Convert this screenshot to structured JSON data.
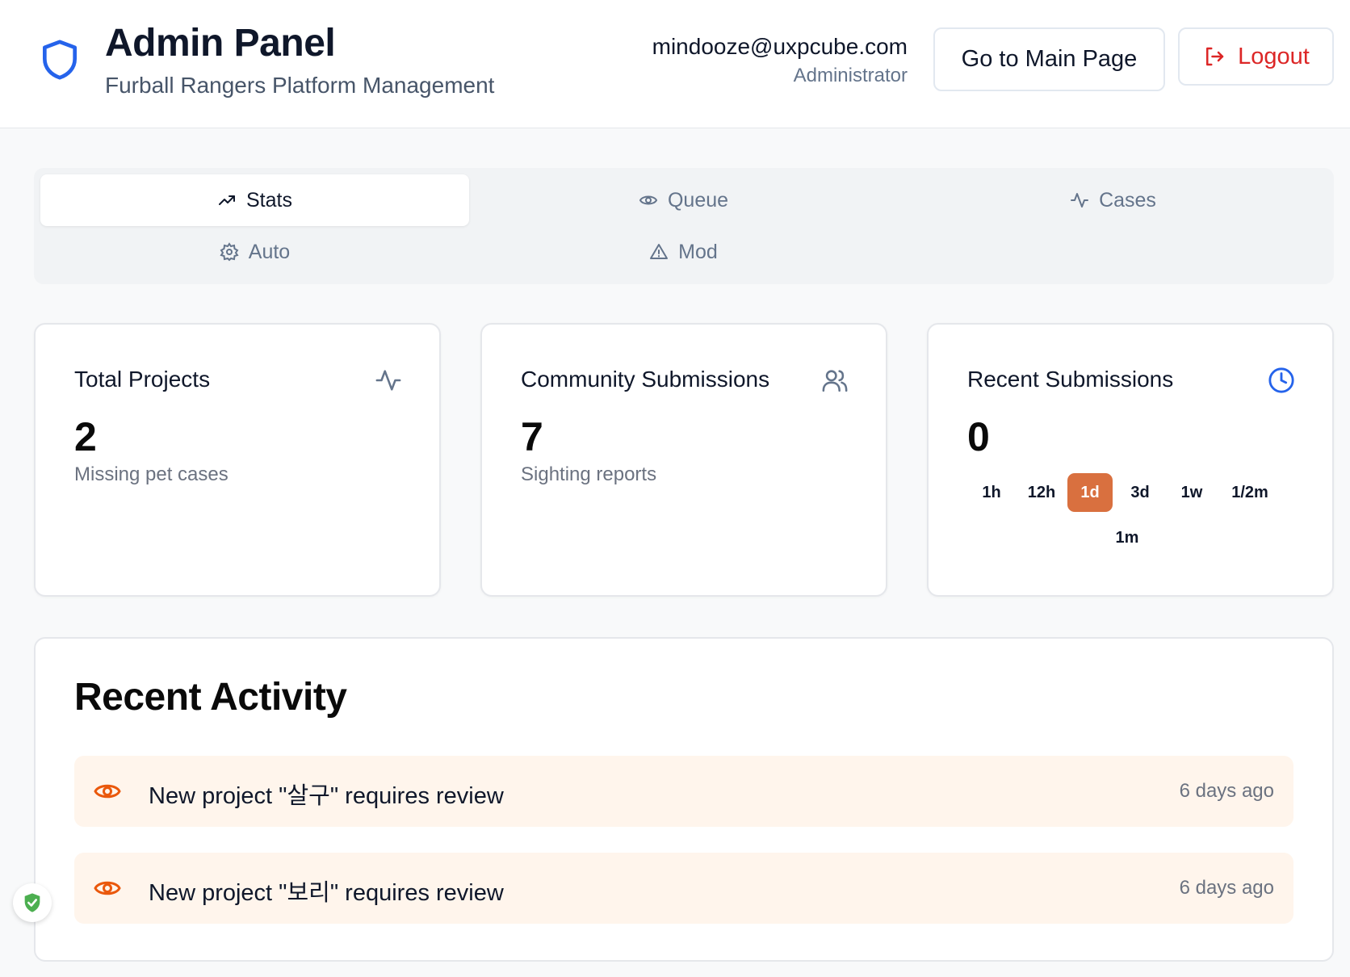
{
  "header": {
    "title": "Admin Panel",
    "subtitle": "Furball Rangers Platform Management",
    "user_email": "mindooze@uxpcube.com",
    "user_role": "Administrator",
    "main_page_label": "Go to Main Page",
    "logout_label": "Logout"
  },
  "tabs": [
    {
      "label": "Stats",
      "icon": "trending-up-icon",
      "active": true
    },
    {
      "label": "Queue",
      "icon": "eye-icon",
      "active": false
    },
    {
      "label": "Cases",
      "icon": "activity-icon",
      "active": false
    },
    {
      "label": "Auto",
      "icon": "gear-icon",
      "active": false
    },
    {
      "label": "Mod",
      "icon": "warning-icon",
      "active": false
    }
  ],
  "stats": {
    "total_projects": {
      "title": "Total Projects",
      "value": "2",
      "desc": "Missing pet cases",
      "icon": "activity-icon"
    },
    "community": {
      "title": "Community Submissions",
      "value": "7",
      "desc": "Sighting reports",
      "icon": "users-icon"
    },
    "recent": {
      "title": "Recent Submissions",
      "value": "0",
      "icon": "clock-icon",
      "ranges": [
        "1h",
        "12h",
        "1d",
        "3d",
        "1w",
        "1/2m",
        "1m"
      ],
      "selected_range": "1d"
    }
  },
  "activity": {
    "title": "Recent Activity",
    "items": [
      {
        "text": "New project \"살구\" requires review",
        "time": "6 days ago",
        "icon": "eye-icon"
      },
      {
        "text": "New project \"보리\" requires review",
        "time": "6 days ago",
        "icon": "eye-icon"
      }
    ]
  },
  "colors": {
    "accent_blue": "#2563eb",
    "accent_orange": "#d9703f",
    "danger": "#dc2626",
    "activity_bg": "#fff5ec"
  }
}
